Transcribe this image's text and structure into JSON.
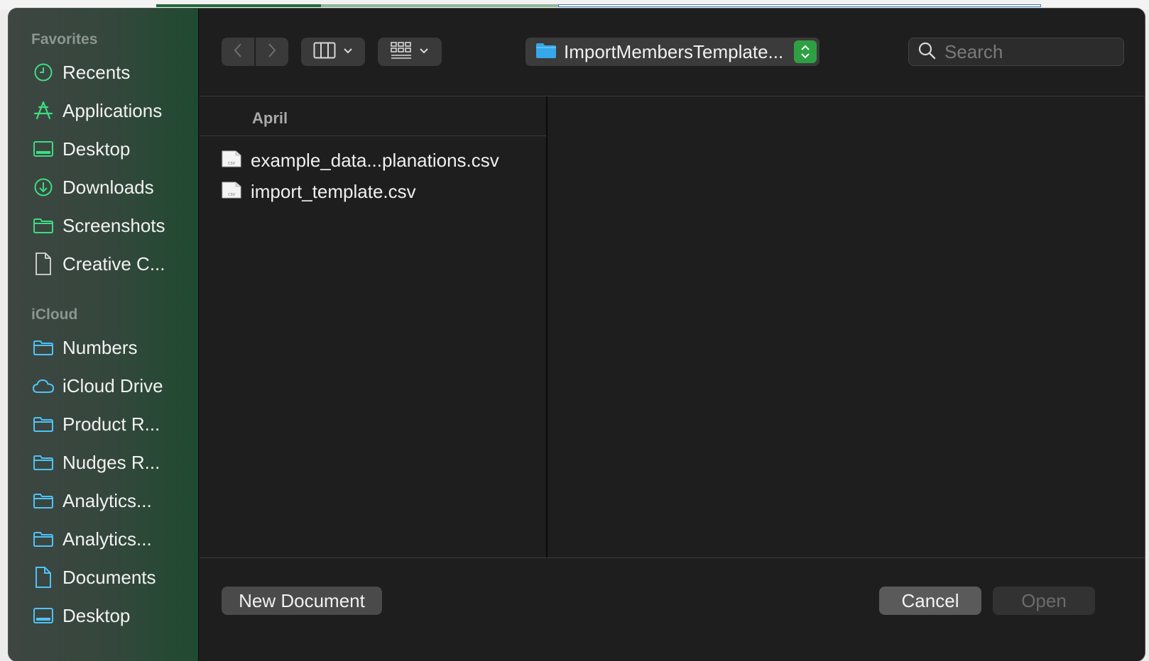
{
  "sidebar": {
    "favorites_header": "Favorites",
    "favorites": [
      {
        "label": "Recents",
        "icon": "clock-icon"
      },
      {
        "label": "Applications",
        "icon": "applications-icon"
      },
      {
        "label": "Desktop",
        "icon": "desktop-icon"
      },
      {
        "label": "Downloads",
        "icon": "downloads-icon"
      },
      {
        "label": "Screenshots",
        "icon": "folder-icon"
      },
      {
        "label": "Creative C...",
        "icon": "document-icon"
      }
    ],
    "icloud_header": "iCloud",
    "icloud": [
      {
        "label": "Numbers",
        "icon": "folder-icon"
      },
      {
        "label": "iCloud Drive",
        "icon": "cloud-icon"
      },
      {
        "label": "Product R...",
        "icon": "folder-icon"
      },
      {
        "label": "Nudges R...",
        "icon": "folder-icon"
      },
      {
        "label": "Analytics...",
        "icon": "folder-icon"
      },
      {
        "label": "Analytics...",
        "icon": "folder-icon"
      },
      {
        "label": "Documents",
        "icon": "document-icon"
      },
      {
        "label": "Desktop",
        "icon": "desktop-icon"
      }
    ]
  },
  "toolbar": {
    "location": "ImportMembersTemplate...",
    "search_placeholder": "Search"
  },
  "browser": {
    "column_header": "April",
    "files": [
      {
        "name": "example_data...planations.csv",
        "icon": "csv-file-icon"
      },
      {
        "name": "import_template.csv",
        "icon": "csv-file-icon"
      }
    ]
  },
  "footer": {
    "new_document": "New Document",
    "cancel": "Cancel",
    "open": "Open"
  },
  "colors": {
    "accent_green": "#2ea043",
    "sidebar_icon": "#3ddc84",
    "folder_blue": "#36a7e8"
  }
}
